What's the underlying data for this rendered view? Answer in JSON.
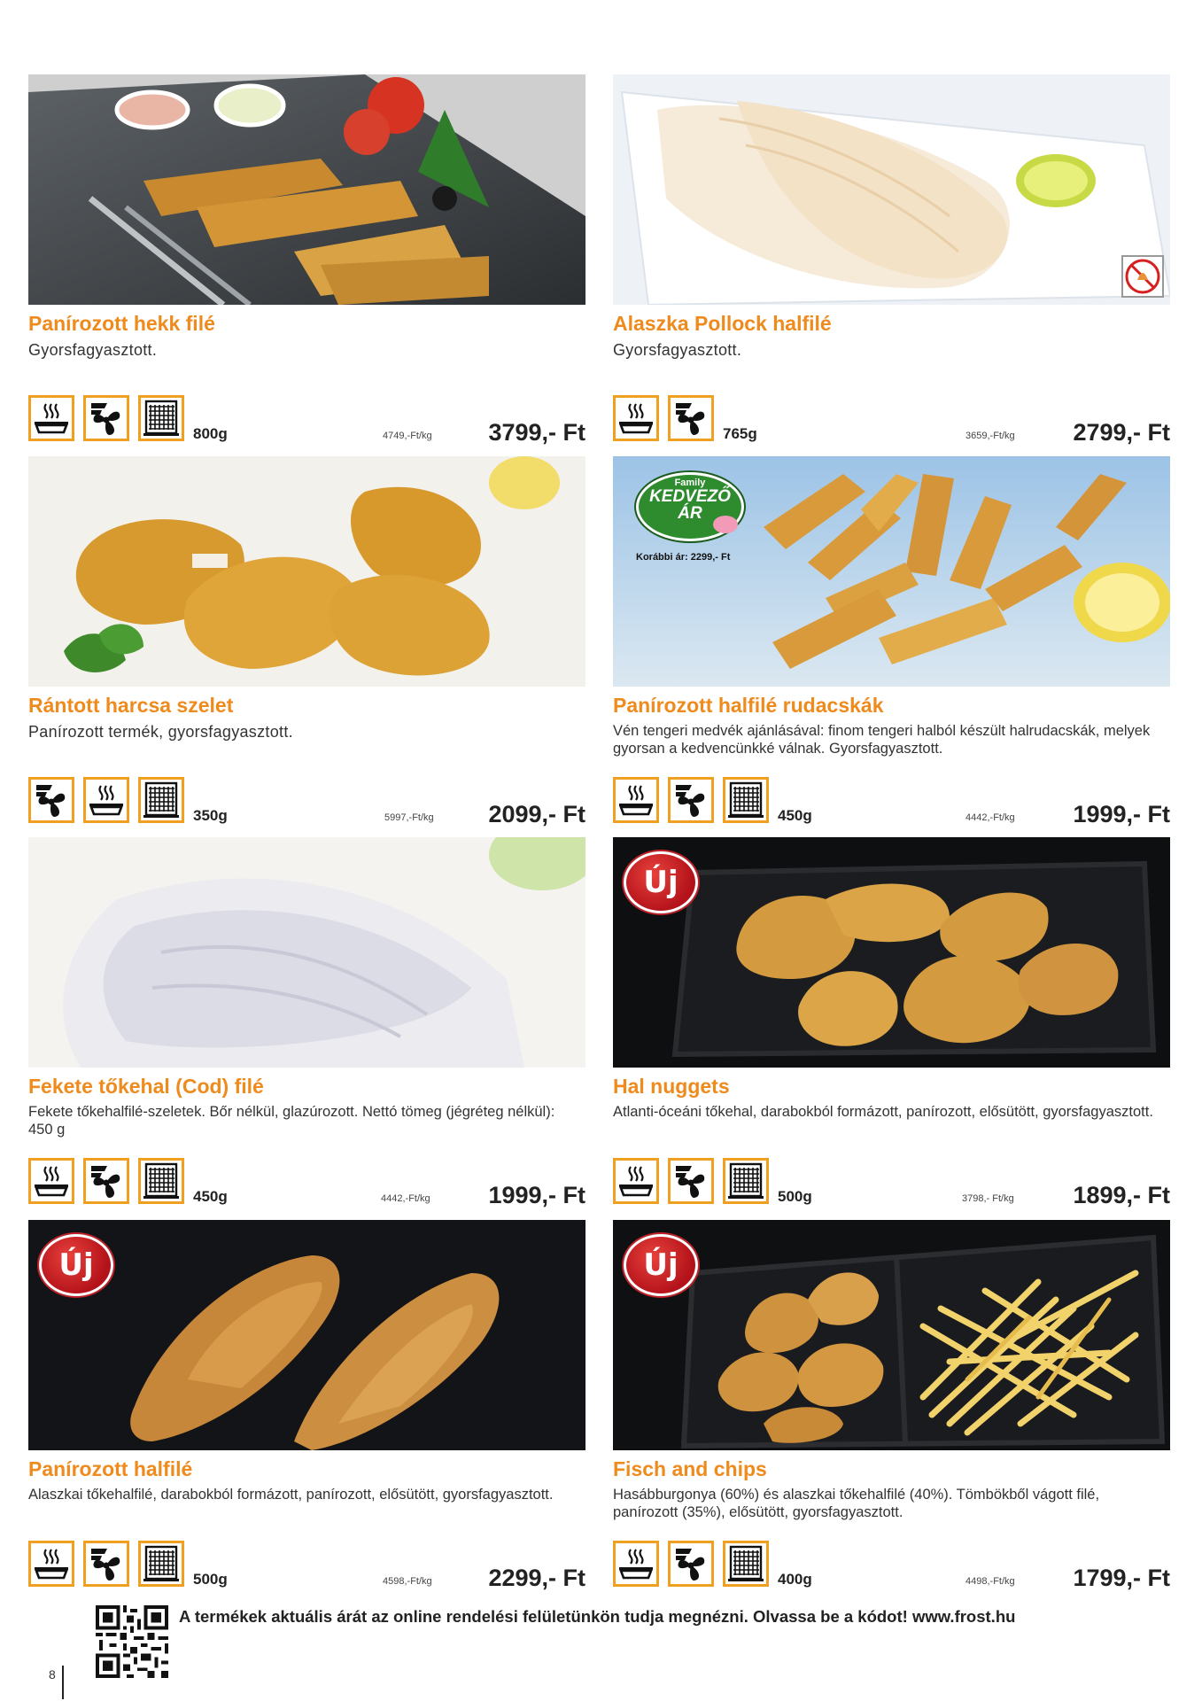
{
  "products": [
    {
      "title": "Panírozott hekk filé",
      "desc": "Gyorsfagyasztott.",
      "weight": "800g",
      "perkg": "4749,-Ft/kg",
      "price": "3799,- Ft"
    },
    {
      "title": "Alaszka Pollock halfilé",
      "desc": "Gyorsfagyasztott.",
      "weight": "765g",
      "perkg": "3659,-Ft/kg",
      "price": "2799,- Ft"
    },
    {
      "title": "Rántott harcsa szelet",
      "desc": "Panírozott termék, gyorsfagyasztott.",
      "weight": "350g",
      "perkg": "5997,-Ft/kg",
      "price": "2099,- Ft"
    },
    {
      "title": "Panírozott halfilé rudacskák",
      "desc": "Vén tengeri medvék ajánlásával:  finom tengeri halból készült halrudacskák, melyek gyorsan a kedvencünkké válnak. Gyorsfagyasztott.",
      "weight": "450g",
      "perkg": "4442,-Ft/kg",
      "price": "1999,- Ft"
    },
    {
      "title": "Fekete tőkehal (Cod) filé",
      "desc": "Fekete tőkehalfilé-szeletek. Bőr nélkül, glazúrozott. Nettó tömeg (jégréteg nélkül): 450 g",
      "weight": "450g",
      "perkg": "4442,-Ft/kg",
      "price": "1999,- Ft"
    },
    {
      "title": "Hal nuggets",
      "desc": "Atlanti-óceáni tőkehal, darabokból formázott, panírozott, elősütött, gyorsfagyasztott.",
      "weight": "500g",
      "perkg": "3798,- Ft/kg",
      "price": "1899,- Ft"
    },
    {
      "title": "Panírozott halfilé",
      "desc": "Alaszkai tőkehalfilé, darabokból formázott, panírozott, elősütött, gyorsfagyasztott.",
      "weight": "500g",
      "perkg": "4598,-Ft/kg",
      "price": "2299,- Ft"
    },
    {
      "title": "Fisch and chips",
      "desc": "Hasábburgonya (60%) és alaszkai tőkehalfilé (40%). Tömbökből vágott filé, panírozott (35%), elősütött, gyorsfagyasztott.",
      "weight": "400g",
      "perkg": "4498,-Ft/kg",
      "price": "1799,- Ft"
    }
  ],
  "badges": {
    "new": "Új",
    "family_top": "Family",
    "family_main1": "KEDVEZŐ",
    "family_main2": "ÁR",
    "previous_price": "Korábbi ár: 2299,- Ft"
  },
  "icons": {
    "pan": "pan-fry-icon",
    "fan": "convection-oven-icon",
    "fryer": "deep-fryer-icon",
    "no_microwave": "no-microwave-icon"
  },
  "colors": {
    "accent": "#ef8a1d",
    "icon_border": "#f0a020",
    "new_badge": "#c02028"
  },
  "footer": {
    "text": "A termékek aktuális árát az online rendelési felületünkön tudja megnézni. Olvassa be a kódot! www.frost.hu",
    "page_number": "8"
  }
}
